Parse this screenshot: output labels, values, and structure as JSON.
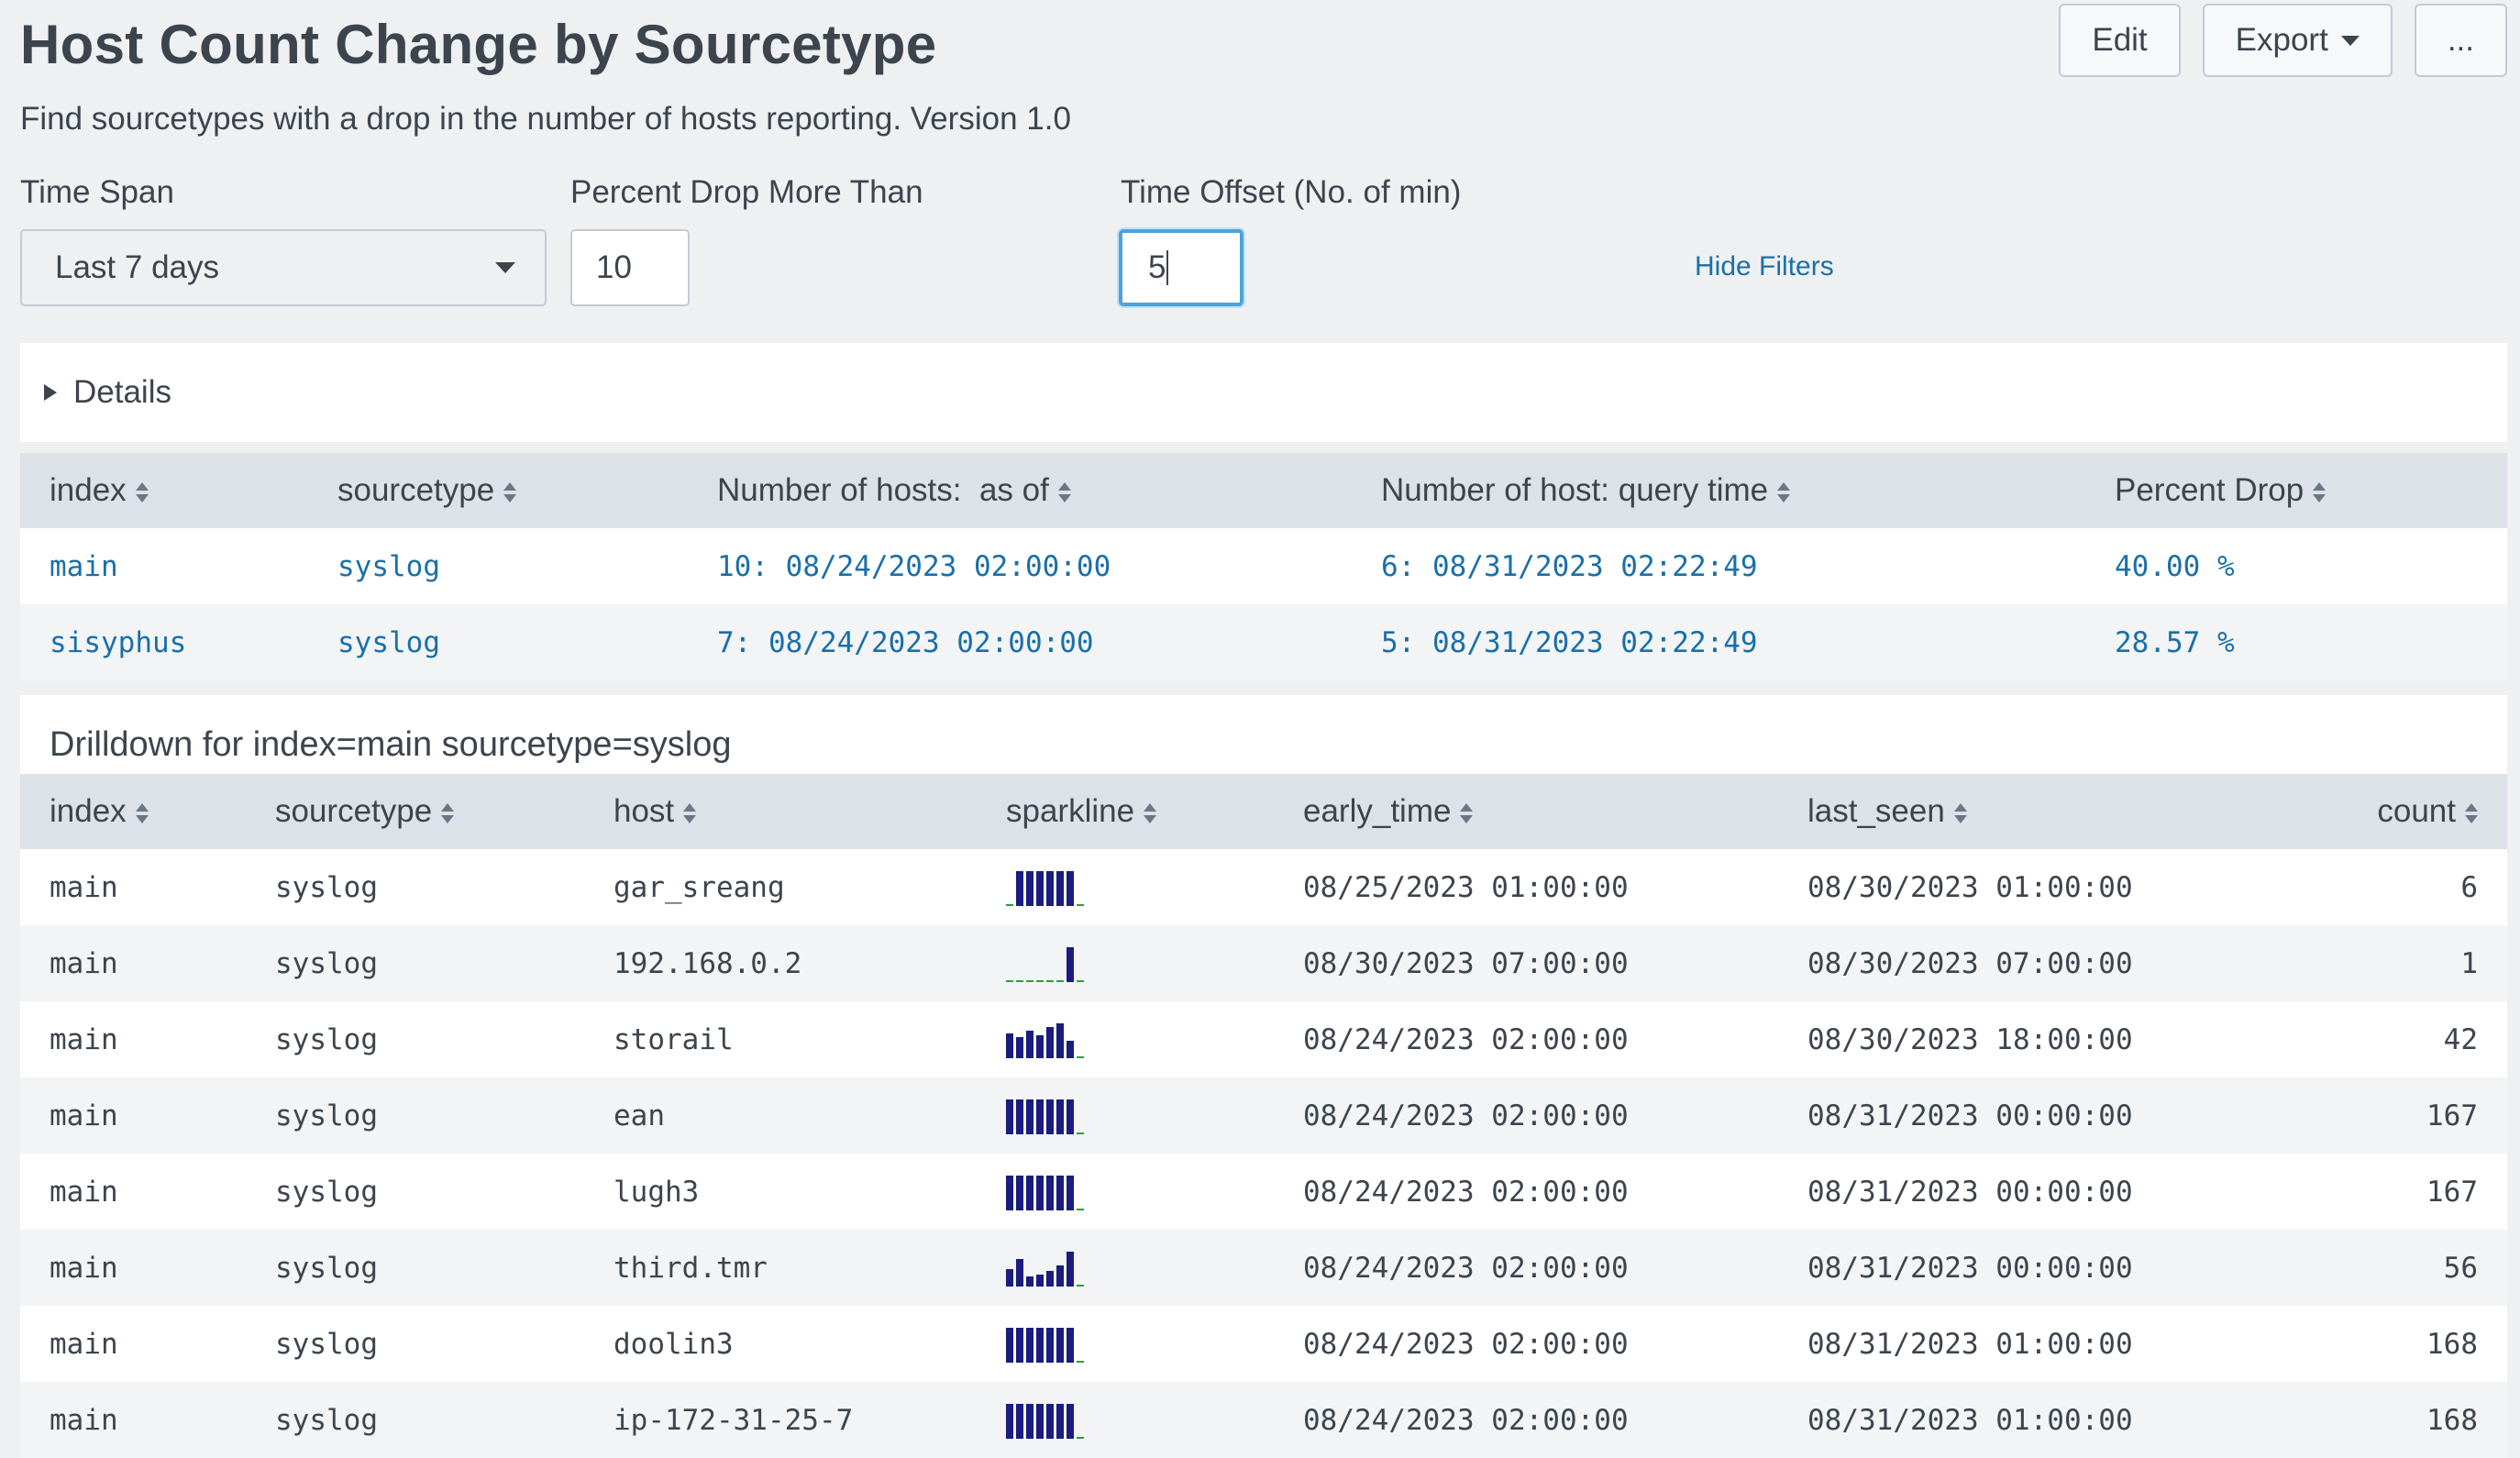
{
  "header": {
    "title": "Host Count Change by Sourcetype",
    "description": "Find sourcetypes with a drop in the number of hosts reporting. Version 1.0",
    "edit_label": "Edit",
    "export_label": "Export",
    "more_label": "..."
  },
  "filters": {
    "time_span_label": "Time Span",
    "time_span_value": "Last 7 days",
    "percent_drop_label": "Percent Drop More Than",
    "percent_drop_value": "10",
    "time_offset_label": "Time Offset (No. of min)",
    "time_offset_value": "5",
    "hide_filters_label": "Hide Filters"
  },
  "details": {
    "label": "Details"
  },
  "summary": {
    "columns": [
      "index",
      "sourcetype",
      "Number of hosts:  as of",
      "Number of host: query time",
      "Percent Drop"
    ],
    "rows": [
      [
        "main",
        "syslog",
        "10: 08/24/2023 02:00:00",
        "6: 08/31/2023 02:22:49",
        "40.00 %"
      ],
      [
        "sisyphus",
        "syslog",
        "7: 08/24/2023 02:00:00",
        "5: 08/31/2023 02:22:49",
        "28.57 %"
      ]
    ]
  },
  "drilldown": {
    "title": "Drilldown for index=main sourcetype=syslog",
    "columns": [
      "index",
      "sourcetype",
      "host",
      "sparkline",
      "early_time",
      "last_seen",
      "count"
    ],
    "rows": [
      {
        "cells": [
          "main",
          "syslog",
          "gar_sreang",
          "",
          "08/25/2023 01:00:00",
          "08/30/2023 01:00:00",
          "6"
        ],
        "spark": [
          0,
          1,
          1,
          1,
          1,
          1,
          1,
          0
        ]
      },
      {
        "cells": [
          "main",
          "syslog",
          "192.168.0.2",
          "",
          "08/30/2023 07:00:00",
          "08/30/2023 07:00:00",
          "1"
        ],
        "spark": [
          0,
          0,
          0,
          0,
          0,
          0,
          1,
          0
        ]
      },
      {
        "cells": [
          "main",
          "syslog",
          "storail",
          "",
          "08/24/2023 02:00:00",
          "08/30/2023 18:00:00",
          "42"
        ],
        "spark": [
          0.7,
          0.6,
          0.8,
          0.65,
          0.9,
          1,
          0.5,
          0
        ]
      },
      {
        "cells": [
          "main",
          "syslog",
          "ean",
          "",
          "08/24/2023 02:00:00",
          "08/31/2023 00:00:00",
          "167"
        ],
        "spark": [
          1,
          1,
          1,
          1,
          1,
          1,
          1,
          0
        ]
      },
      {
        "cells": [
          "main",
          "syslog",
          "lugh3",
          "",
          "08/24/2023 02:00:00",
          "08/31/2023 00:00:00",
          "167"
        ],
        "spark": [
          1,
          1,
          1,
          1,
          1,
          1,
          1,
          0
        ]
      },
      {
        "cells": [
          "main",
          "syslog",
          "third.tmr",
          "",
          "08/24/2023 02:00:00",
          "08/31/2023 00:00:00",
          "56"
        ],
        "spark": [
          0.5,
          0.8,
          0.3,
          0.35,
          0.45,
          0.6,
          1,
          0
        ]
      },
      {
        "cells": [
          "main",
          "syslog",
          "doolin3",
          "",
          "08/24/2023 02:00:00",
          "08/31/2023 01:00:00",
          "168"
        ],
        "spark": [
          1,
          1,
          1,
          1,
          1,
          1,
          1,
          0
        ]
      },
      {
        "cells": [
          "main",
          "syslog",
          "ip-172-31-25-7",
          "",
          "08/24/2023 02:00:00",
          "08/31/2023 01:00:00",
          "168"
        ],
        "spark": [
          1,
          1,
          1,
          1,
          1,
          1,
          1,
          0
        ]
      }
    ]
  },
  "colors": {
    "link": "#1a6fa8",
    "sparkline_bar": "#1a1c80",
    "sparkline_zero": "#2e9e3e",
    "focus_ring": "#4da3d9"
  }
}
